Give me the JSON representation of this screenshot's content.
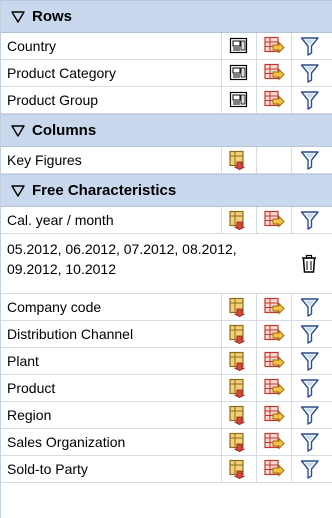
{
  "sections": {
    "rows": {
      "title": "Rows",
      "items": [
        {
          "label": "Country"
        },
        {
          "label": "Product Category"
        },
        {
          "label": "Product Group"
        }
      ]
    },
    "columns": {
      "title": "Columns",
      "items": [
        {
          "label": "Key Figures"
        }
      ]
    },
    "free": {
      "title": "Free Characteristics",
      "first": {
        "label": "Cal. year / month"
      },
      "filter_value": "05.2012, 06.2012, 07.2012, 08.2012, 09.2012, 10.2012",
      "items": [
        {
          "label": "Company code"
        },
        {
          "label": "Distribution Channel"
        },
        {
          "label": "Plant"
        },
        {
          "label": "Product"
        },
        {
          "label": "Region"
        },
        {
          "label": "Sales Organization"
        },
        {
          "label": "Sold-to Party"
        }
      ]
    }
  },
  "colors": {
    "header_bg": "#c9d8ec",
    "icon_yellow": "#f6c244",
    "icon_red": "#d9443a",
    "icon_blue": "#3a6fbd"
  },
  "icons": {
    "collapse": "triangle-down-icon",
    "key_display": "key-display-icon",
    "swap_axis": "swap-axis-icon",
    "filter": "filter-icon",
    "delete": "trash-icon"
  }
}
